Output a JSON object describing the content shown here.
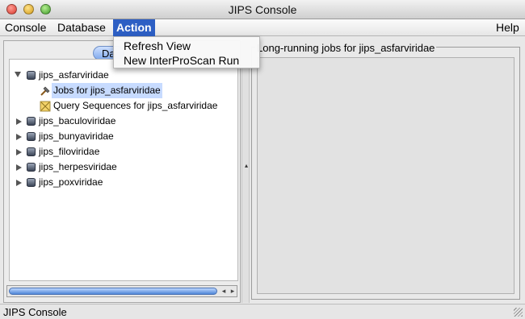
{
  "window": {
    "title": "JIPS Console"
  },
  "menubar": {
    "console": "Console",
    "database": "Database",
    "action": "Action",
    "help": "Help"
  },
  "action_menu": {
    "items": [
      "Refresh View",
      "New InterProScan Run"
    ]
  },
  "left_panel": {
    "tab_label": "Da",
    "tree": {
      "expanded_db": "jips_asfarviridae",
      "children": [
        "Jobs for jips_asfarviridae",
        "Query Sequences for jips_asfarviridae"
      ],
      "selected": "Jobs for jips_asfarviridae",
      "other_dbs": [
        "jips_baculoviridae",
        "jips_bunyaviridae",
        "jips_filoviridae",
        "jips_herpesviridae",
        "jips_poxviridae"
      ]
    }
  },
  "right_panel": {
    "title": "Long-running jobs for jips_asfarviridae"
  },
  "statusbar": {
    "text": "JIPS Console"
  },
  "colors": {
    "menu_highlight": "#2d5fc4",
    "selection": "#c7dbff"
  }
}
